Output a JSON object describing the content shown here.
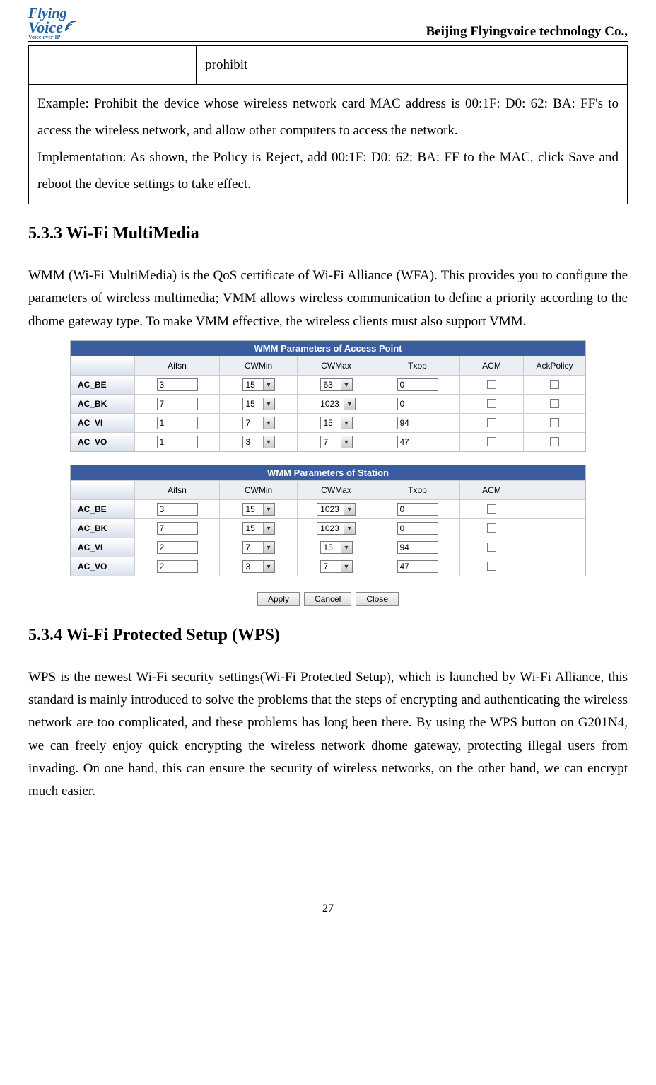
{
  "header": {
    "logo_line1": "Flying",
    "logo_line2": "Voice",
    "logo_tag": "Voice over IP",
    "company": "Beijing Flyingvoice technology Co.,"
  },
  "table": {
    "r1c2": "prohibit",
    "example": "Example: Prohibit the device whose wireless network card MAC address is 00:1F: D0: 62: BA: FF's to access the wireless network, and allow other computers to access the network.",
    "impl": "Implementation: As shown, the Policy is Reject, add 00:1F: D0: 62: BA: FF to the MAC, click Save and reboot the device settings to take effect."
  },
  "sections": {
    "s533": "5.3.3 Wi-Fi MultiMedia",
    "s533_body": "WMM (Wi-Fi MultiMedia) is the QoS certificate of Wi-Fi Alliance (WFA). This provides you to configure the parameters of wireless multimedia; VMM allows wireless communication to define a priority according to the dhome gateway type. To make VMM effective, the wireless clients must also support VMM.",
    "s534": "5.3.4 Wi-Fi Protected Setup (WPS)",
    "s534_body": "WPS is the newest Wi-Fi security settings(Wi-Fi Protected Setup), which is launched by Wi-Fi Alliance, this standard is mainly introduced to solve the problems that the steps of encrypting and authenticating the wireless network are too complicated, and these problems has long been there. By using the WPS button on G201N4, we can freely enjoy quick encrypting the wireless network dhome gateway, protecting illegal users from invading. On one hand, this can ensure the security of wireless networks, on the other hand, we can encrypt much easier."
  },
  "wmm": {
    "ap_title": "WMM Parameters of Access Point",
    "st_title": "WMM Parameters of Station",
    "headers6": [
      "Aifsn",
      "CWMin",
      "CWMax",
      "Txop",
      "ACM",
      "AckPolicy"
    ],
    "headers5": [
      "Aifsn",
      "CWMin",
      "CWMax",
      "Txop",
      "ACM"
    ],
    "labels": [
      "AC_BE",
      "AC_BK",
      "AC_VI",
      "AC_VO"
    ],
    "ap_rows": [
      {
        "aifsn": "3",
        "cwmin": "15",
        "cwmax": "63",
        "txop": "0"
      },
      {
        "aifsn": "7",
        "cwmin": "15",
        "cwmax": "1023",
        "txop": "0"
      },
      {
        "aifsn": "1",
        "cwmin": "7",
        "cwmax": "15",
        "txop": "94"
      },
      {
        "aifsn": "1",
        "cwmin": "3",
        "cwmax": "7",
        "txop": "47"
      }
    ],
    "st_rows": [
      {
        "aifsn": "3",
        "cwmin": "15",
        "cwmax": "1023",
        "txop": "0"
      },
      {
        "aifsn": "7",
        "cwmin": "15",
        "cwmax": "1023",
        "txop": "0"
      },
      {
        "aifsn": "2",
        "cwmin": "7",
        "cwmax": "15",
        "txop": "94"
      },
      {
        "aifsn": "2",
        "cwmin": "3",
        "cwmax": "7",
        "txop": "47"
      }
    ],
    "buttons": {
      "apply": "Apply",
      "cancel": "Cancel",
      "close": "Close"
    }
  },
  "page_num": "27"
}
